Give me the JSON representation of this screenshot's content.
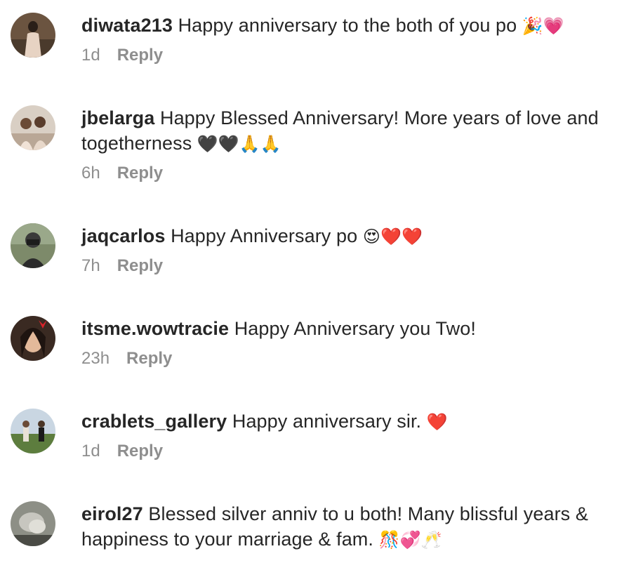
{
  "comments": [
    {
      "username": "diwata213",
      "text": "Happy anniversary to the both of you po",
      "emoji": "🎉💗",
      "time": "1d",
      "reply_label": "Reply"
    },
    {
      "username": "jbelarga",
      "text": "Happy Blessed Anniversary! More years of love and togetherness",
      "emoji": "🖤🖤🙏🙏",
      "time": "6h",
      "reply_label": "Reply"
    },
    {
      "username": "jaqcarlos",
      "text": "Happy Anniversary po",
      "emoji": "😍❤️❤️",
      "time": "7h",
      "reply_label": "Reply"
    },
    {
      "username": "itsme.wowtracie",
      "text": "Happy Anniversary you Two!",
      "emoji": "",
      "time": "23h",
      "reply_label": "Reply"
    },
    {
      "username": "crablets_gallery",
      "text": "Happy anniversary sir.",
      "emoji": "❤️",
      "time": "1d",
      "reply_label": "Reply"
    },
    {
      "username": "eirol27",
      "text": "Blessed silver anniv to u both! Many blissful years & happiness to your marriage & fam.",
      "emoji": "🎊💞🥂",
      "time": "",
      "reply_label": ""
    }
  ]
}
